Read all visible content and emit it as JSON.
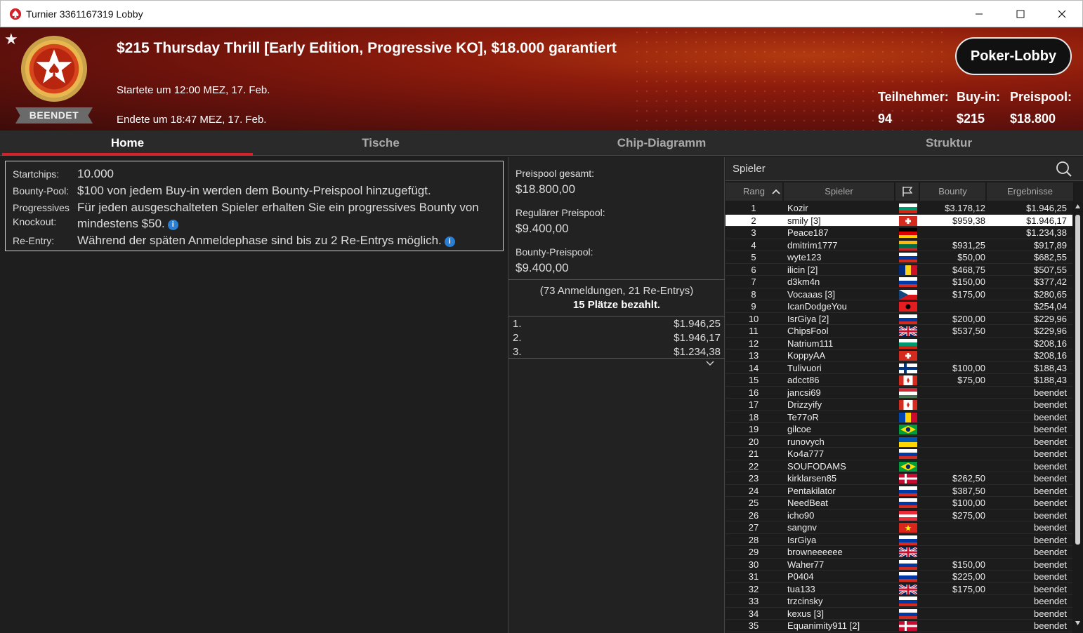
{
  "window": {
    "title": "Turnier 3361167319 Lobby"
  },
  "header": {
    "tournament_name": "$215 Thursday Thrill [Early Edition, Progressive KO], $18.000 garantiert",
    "started": "Startete um 12:00 MEZ, 17. Feb.",
    "ended": "Endete um 18:47 MEZ, 17. Feb.",
    "status_badge": "BEENDET",
    "lobby_button": "Poker-Lobby",
    "stats": [
      {
        "label": "Teilnehmer:",
        "value": "94"
      },
      {
        "label": "Buy-in:",
        "value": "$215"
      },
      {
        "label": "Preispool:",
        "value": "$18.800"
      }
    ]
  },
  "tabs": [
    "Home",
    "Tische",
    "Chip-Diagramm",
    "Struktur"
  ],
  "info": {
    "startchips_label": "Startchips:",
    "startchips_value": "10.000",
    "bounty_label": "Bounty-Pool:",
    "bounty_value": "$100 von jedem Buy-in werden dem Bounty-Preispool hinzugefügt.",
    "pko_label_1": "Progressives",
    "pko_label_2": "Knockout:",
    "pko_value_1": "Für jeden ausgeschalteten Spieler erhalten Sie ein progressives Bounty von",
    "pko_value_2": "mindestens $50.",
    "reentry_label": "Re-Entry:",
    "reentry_value": "Während der späten Anmeldephase sind bis zu 2 Re-Entrys möglich.",
    "info_glyph": "i"
  },
  "prizepool": {
    "total_label": "Preispool gesamt:",
    "total_value": "$18.800,00",
    "regular_label": "Regulärer Preispool:",
    "regular_value": "$9.400,00",
    "bounty_label": "Bounty-Preispool:",
    "bounty_value": "$9.400,00",
    "registrations": "(73 Anmeldungen, 21 Re-Entrys)",
    "paid": "15 Plätze bezahlt.",
    "payouts": [
      {
        "place": "1.",
        "amount": "$1.946,25"
      },
      {
        "place": "2.",
        "amount": "$1.946,17"
      },
      {
        "place": "3.",
        "amount": "$1.234,38"
      }
    ]
  },
  "players": {
    "title": "Spieler",
    "columns": {
      "rank": "Rang",
      "player": "Spieler",
      "bounty": "Bounty",
      "result": "Ergebnisse"
    },
    "selected_rank": "2",
    "rows": [
      {
        "rank": "1",
        "name": "Kozir",
        "flag": "bg",
        "bounty": "$3.178,12",
        "result": "$1.946,25"
      },
      {
        "rank": "2",
        "name": "smily [3]",
        "flag": "ch",
        "bounty": "$959,38",
        "result": "$1.946,17"
      },
      {
        "rank": "3",
        "name": "Peace187",
        "flag": "de",
        "bounty": "",
        "result": "$1.234,38"
      },
      {
        "rank": "4",
        "name": "dmitrim1777",
        "flag": "lt",
        "bounty": "$931,25",
        "result": "$917,89"
      },
      {
        "rank": "5",
        "name": "wyte123",
        "flag": "ru",
        "bounty": "$50,00",
        "result": "$682,55"
      },
      {
        "rank": "6",
        "name": "ilicin [2]",
        "flag": "ro",
        "bounty": "$468,75",
        "result": "$507,55"
      },
      {
        "rank": "7",
        "name": "d3km4n",
        "flag": "ru",
        "bounty": "$150,00",
        "result": "$377,42"
      },
      {
        "rank": "8",
        "name": "Vocaaas [3]",
        "flag": "cz",
        "bounty": "$175,00",
        "result": "$280,65"
      },
      {
        "rank": "9",
        "name": "IcanDodgeYou",
        "flag": "al",
        "bounty": "",
        "result": "$254,04"
      },
      {
        "rank": "10",
        "name": "IsrGiya [2]",
        "flag": "ru",
        "bounty": "$200,00",
        "result": "$229,96"
      },
      {
        "rank": "11",
        "name": "ChipsFool",
        "flag": "gb",
        "bounty": "$537,50",
        "result": "$229,96"
      },
      {
        "rank": "12",
        "name": "Natrium111",
        "flag": "bg",
        "bounty": "",
        "result": "$208,16"
      },
      {
        "rank": "13",
        "name": "KoppyAA",
        "flag": "ch",
        "bounty": "",
        "result": "$208,16"
      },
      {
        "rank": "14",
        "name": "Tulivuori",
        "flag": "fi",
        "bounty": "$100,00",
        "result": "$188,43"
      },
      {
        "rank": "15",
        "name": "adcct86",
        "flag": "ca",
        "bounty": "$75,00",
        "result": "$188,43"
      },
      {
        "rank": "16",
        "name": "jancsi69",
        "flag": "hu",
        "bounty": "",
        "result": "beendet"
      },
      {
        "rank": "17",
        "name": "Drizzyify",
        "flag": "ca",
        "bounty": "",
        "result": "beendet"
      },
      {
        "rank": "18",
        "name": "Te77oR",
        "flag": "md",
        "bounty": "",
        "result": "beendet"
      },
      {
        "rank": "19",
        "name": "gilcoe",
        "flag": "br",
        "bounty": "",
        "result": "beendet"
      },
      {
        "rank": "20",
        "name": "runovych",
        "flag": "ua",
        "bounty": "",
        "result": "beendet"
      },
      {
        "rank": "21",
        "name": "Ko4a777",
        "flag": "ru",
        "bounty": "",
        "result": "beendet"
      },
      {
        "rank": "22",
        "name": "SOUFODAMS",
        "flag": "br",
        "bounty": "",
        "result": "beendet"
      },
      {
        "rank": "23",
        "name": "kirklarsen85",
        "flag": "dk",
        "bounty": "$262,50",
        "result": "beendet"
      },
      {
        "rank": "24",
        "name": "Pentakilator",
        "flag": "ru",
        "bounty": "$387,50",
        "result": "beendet"
      },
      {
        "rank": "25",
        "name": "NeedBeat",
        "flag": "ru",
        "bounty": "$100,00",
        "result": "beendet"
      },
      {
        "rank": "26",
        "name": "icho90",
        "flag": "at",
        "bounty": "$275,00",
        "result": "beendet"
      },
      {
        "rank": "27",
        "name": "sangnv",
        "flag": "vn",
        "bounty": "",
        "result": "beendet"
      },
      {
        "rank": "28",
        "name": "IsrGiya",
        "flag": "ru",
        "bounty": "",
        "result": "beendet"
      },
      {
        "rank": "29",
        "name": "browneeeeee",
        "flag": "gb",
        "bounty": "",
        "result": "beendet"
      },
      {
        "rank": "30",
        "name": "Waher77",
        "flag": "ru",
        "bounty": "$150,00",
        "result": "beendet"
      },
      {
        "rank": "31",
        "name": "P0404",
        "flag": "ru",
        "bounty": "$225,00",
        "result": "beendet"
      },
      {
        "rank": "32",
        "name": "tua133",
        "flag": "gb",
        "bounty": "$175,00",
        "result": "beendet"
      },
      {
        "rank": "33",
        "name": "trzcinsky",
        "flag": "ru",
        "bounty": "",
        "result": "beendet"
      },
      {
        "rank": "34",
        "name": "kexus [3]",
        "flag": "ru",
        "bounty": "",
        "result": "beendet"
      },
      {
        "rank": "35",
        "name": "Equanimity911 [2]",
        "flag": "dk",
        "bounty": "",
        "result": "beendet"
      }
    ]
  },
  "colors": {
    "accent_red": "#d2232a",
    "selected_row": "#ffffff",
    "panel_bg": "#222222"
  },
  "icons": [
    "spade-logo-icon",
    "minimize-icon",
    "maximize-icon",
    "close-icon",
    "favorite-star-icon",
    "search-icon",
    "flag-icon",
    "sort-asc-icon",
    "chevron-down-icon",
    "info-icon"
  ]
}
